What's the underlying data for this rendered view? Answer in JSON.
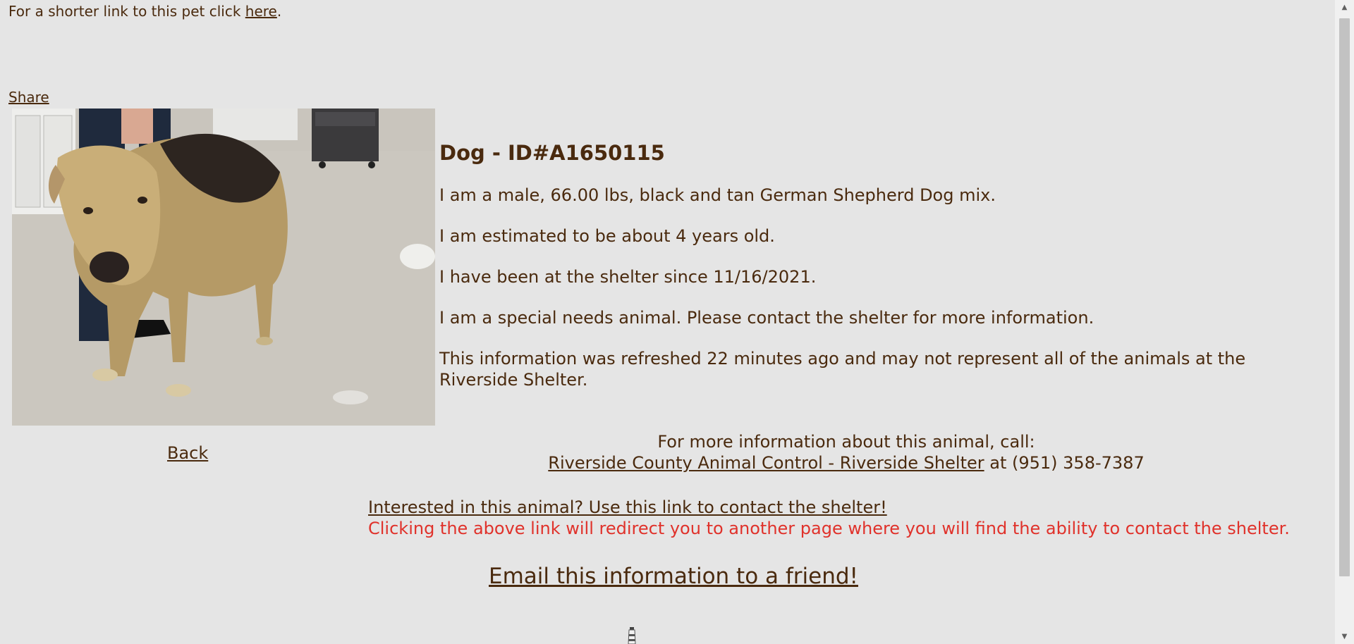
{
  "header": {
    "short_link_prefix": "For a shorter link to this pet click ",
    "short_link_label": "here",
    "short_link_suffix": "."
  },
  "share_label": "Share",
  "animal": {
    "title": "Dog - ID#A1650115",
    "description": "I am a male, 66.00 lbs, black and tan German Shepherd Dog mix.",
    "age": "I am estimated to be about 4 years old.",
    "since": "I have been at the shelter since 11/16/2021.",
    "special_needs": "I am a special needs animal. Please contact the shelter for more information.",
    "refresh_note": "This information was refreshed 22 minutes ago and may not represent all of the animals at the Riverside Shelter."
  },
  "back_label": "Back",
  "contact": {
    "call_text": "For more information about this animal, call:",
    "shelter_link": "Riverside County Animal Control - Riverside Shelter",
    "phone_text": " at (951) 358-7387"
  },
  "interest": {
    "link_label": "Interested in this animal? Use this link to contact the shelter!",
    "note": "Clicking the above link will redirect you to another page where you will find the ability to contact the shelter."
  },
  "email_label": "Email this information to a friend!",
  "icons": {
    "scroll_up": "scroll-up-arrow",
    "scroll_down": "scroll-down-arrow",
    "lighthouse": "lighthouse-icon"
  },
  "colors": {
    "text": "#4a2a0e",
    "alert": "#e0322b",
    "background": "#e5e5e5"
  }
}
